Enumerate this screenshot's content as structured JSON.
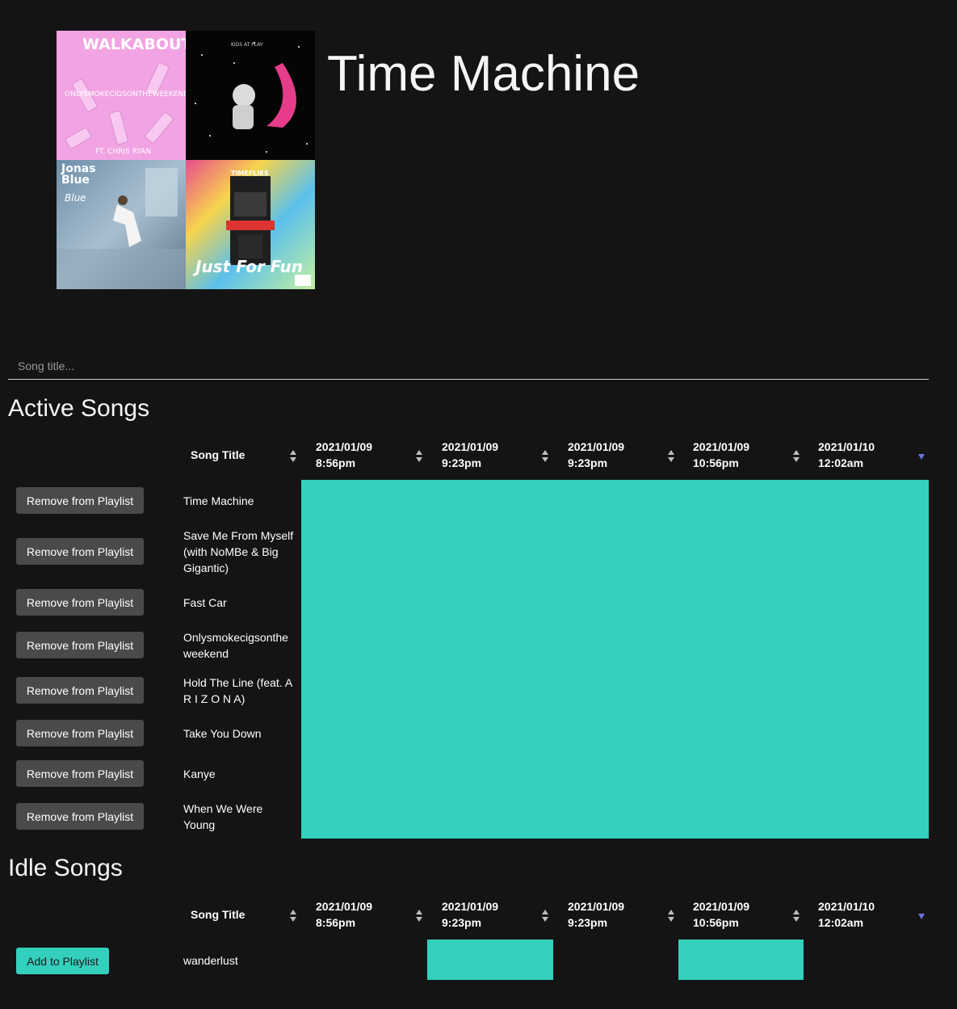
{
  "playlist": {
    "title": "Time Machine",
    "covers": [
      {
        "name": "walkabout-cover",
        "texts": [
          "WALKABOUT",
          "ONLYSMOKECIGSONTHEWEEKEND",
          "FT. CHRIS RYAN"
        ]
      },
      {
        "name": "kids-at-play-cover",
        "texts": [
          "KIDS AT PLAY"
        ]
      },
      {
        "name": "jonas-blue-cover",
        "texts": [
          "Jonas Blue",
          "Blue"
        ]
      },
      {
        "name": "timeflies-cover",
        "texts": [
          "TIMEFLIES",
          "Just For Fun"
        ]
      }
    ]
  },
  "search": {
    "placeholder": "Song title..."
  },
  "columns": {
    "song_title": "Song Title",
    "dates": [
      {
        "date": "2021/01/09",
        "time": "8:56pm"
      },
      {
        "date": "2021/01/09",
        "time": "9:23pm"
      },
      {
        "date": "2021/01/09",
        "time": "9:23pm"
      },
      {
        "date": "2021/01/09",
        "time": "10:56pm"
      },
      {
        "date": "2021/01/10",
        "time": "12:02am"
      }
    ]
  },
  "active": {
    "heading": "Active Songs",
    "button_label": "Remove from Playlist",
    "songs": [
      {
        "title": "Time Machine"
      },
      {
        "title": "Save Me From Myself (with NoMBe & Big Gigantic)"
      },
      {
        "title": "Fast Car"
      },
      {
        "title": "Onlysmokecigsonthe weekend"
      },
      {
        "title": "Hold The Line (feat. A R I Z O N A)"
      },
      {
        "title": "Take You Down"
      },
      {
        "title": "Kanye"
      },
      {
        "title": "When We Were Young"
      }
    ]
  },
  "idle": {
    "heading": "Idle Songs",
    "button_label": "Add to Playlist",
    "songs": [
      {
        "title": "wanderlust",
        "present": [
          false,
          true,
          false,
          true,
          false
        ]
      }
    ]
  },
  "colors": {
    "accent": "#33d0bd",
    "background": "#141414",
    "button": "#4a4a4a",
    "sort_active": "#6b74d6"
  }
}
